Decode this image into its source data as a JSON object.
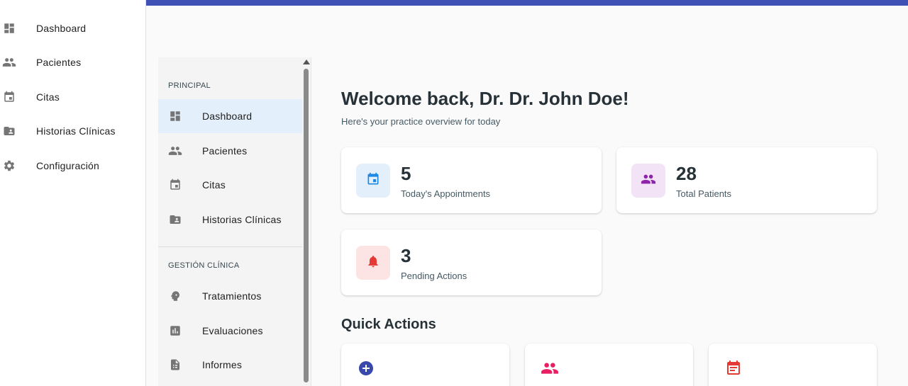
{
  "outer_nav": [
    {
      "label": "Dashboard",
      "icon": "dashboard-icon"
    },
    {
      "label": "Pacientes",
      "icon": "people-icon"
    },
    {
      "label": "Citas",
      "icon": "calendar-icon"
    },
    {
      "label": "Historias Clínicas",
      "icon": "folder-shared-icon"
    },
    {
      "label": "Configuración",
      "icon": "gear-icon"
    }
  ],
  "inner_nav": {
    "sections": [
      {
        "title": "PRINCIPAL",
        "items": [
          {
            "label": "Dashboard",
            "icon": "dashboard-icon",
            "active": true
          },
          {
            "label": "Pacientes",
            "icon": "people-icon"
          },
          {
            "label": "Citas",
            "icon": "calendar-icon"
          },
          {
            "label": "Historias Clínicas",
            "icon": "folder-shared-icon"
          }
        ]
      },
      {
        "title": "GESTIÓN CLÍNICA",
        "items": [
          {
            "label": "Tratamientos",
            "icon": "psychology-icon"
          },
          {
            "label": "Evaluaciones",
            "icon": "bar-chart-icon"
          },
          {
            "label": "Informes",
            "icon": "report-icon"
          }
        ]
      }
    ]
  },
  "main": {
    "welcome": "Welcome back, Dr. Dr. John Doe!",
    "subtitle": "Here's your practice overview for today",
    "stats": [
      {
        "value": "5",
        "label": "Today's Appointments",
        "icon": "calendar-icon",
        "color": "#1e88e5",
        "bg": "#e3f0fb"
      },
      {
        "value": "28",
        "label": "Total Patients",
        "icon": "people-icon",
        "color": "#8e24aa",
        "bg": "#f3e3f7"
      },
      {
        "value": "3",
        "label": "Pending Actions",
        "icon": "bell-icon",
        "color": "#e53935",
        "bg": "#fde4e4"
      }
    ],
    "quick_actions_title": "Quick Actions",
    "quick_actions": [
      {
        "icon": "add-circle-icon",
        "color": "#3949ab"
      },
      {
        "icon": "people-icon",
        "color": "#e91e63"
      },
      {
        "icon": "event-note-icon",
        "color": "#e53935"
      }
    ]
  },
  "colors": {
    "accent": "#3f51b5",
    "active_bg": "#e3f0fb"
  }
}
